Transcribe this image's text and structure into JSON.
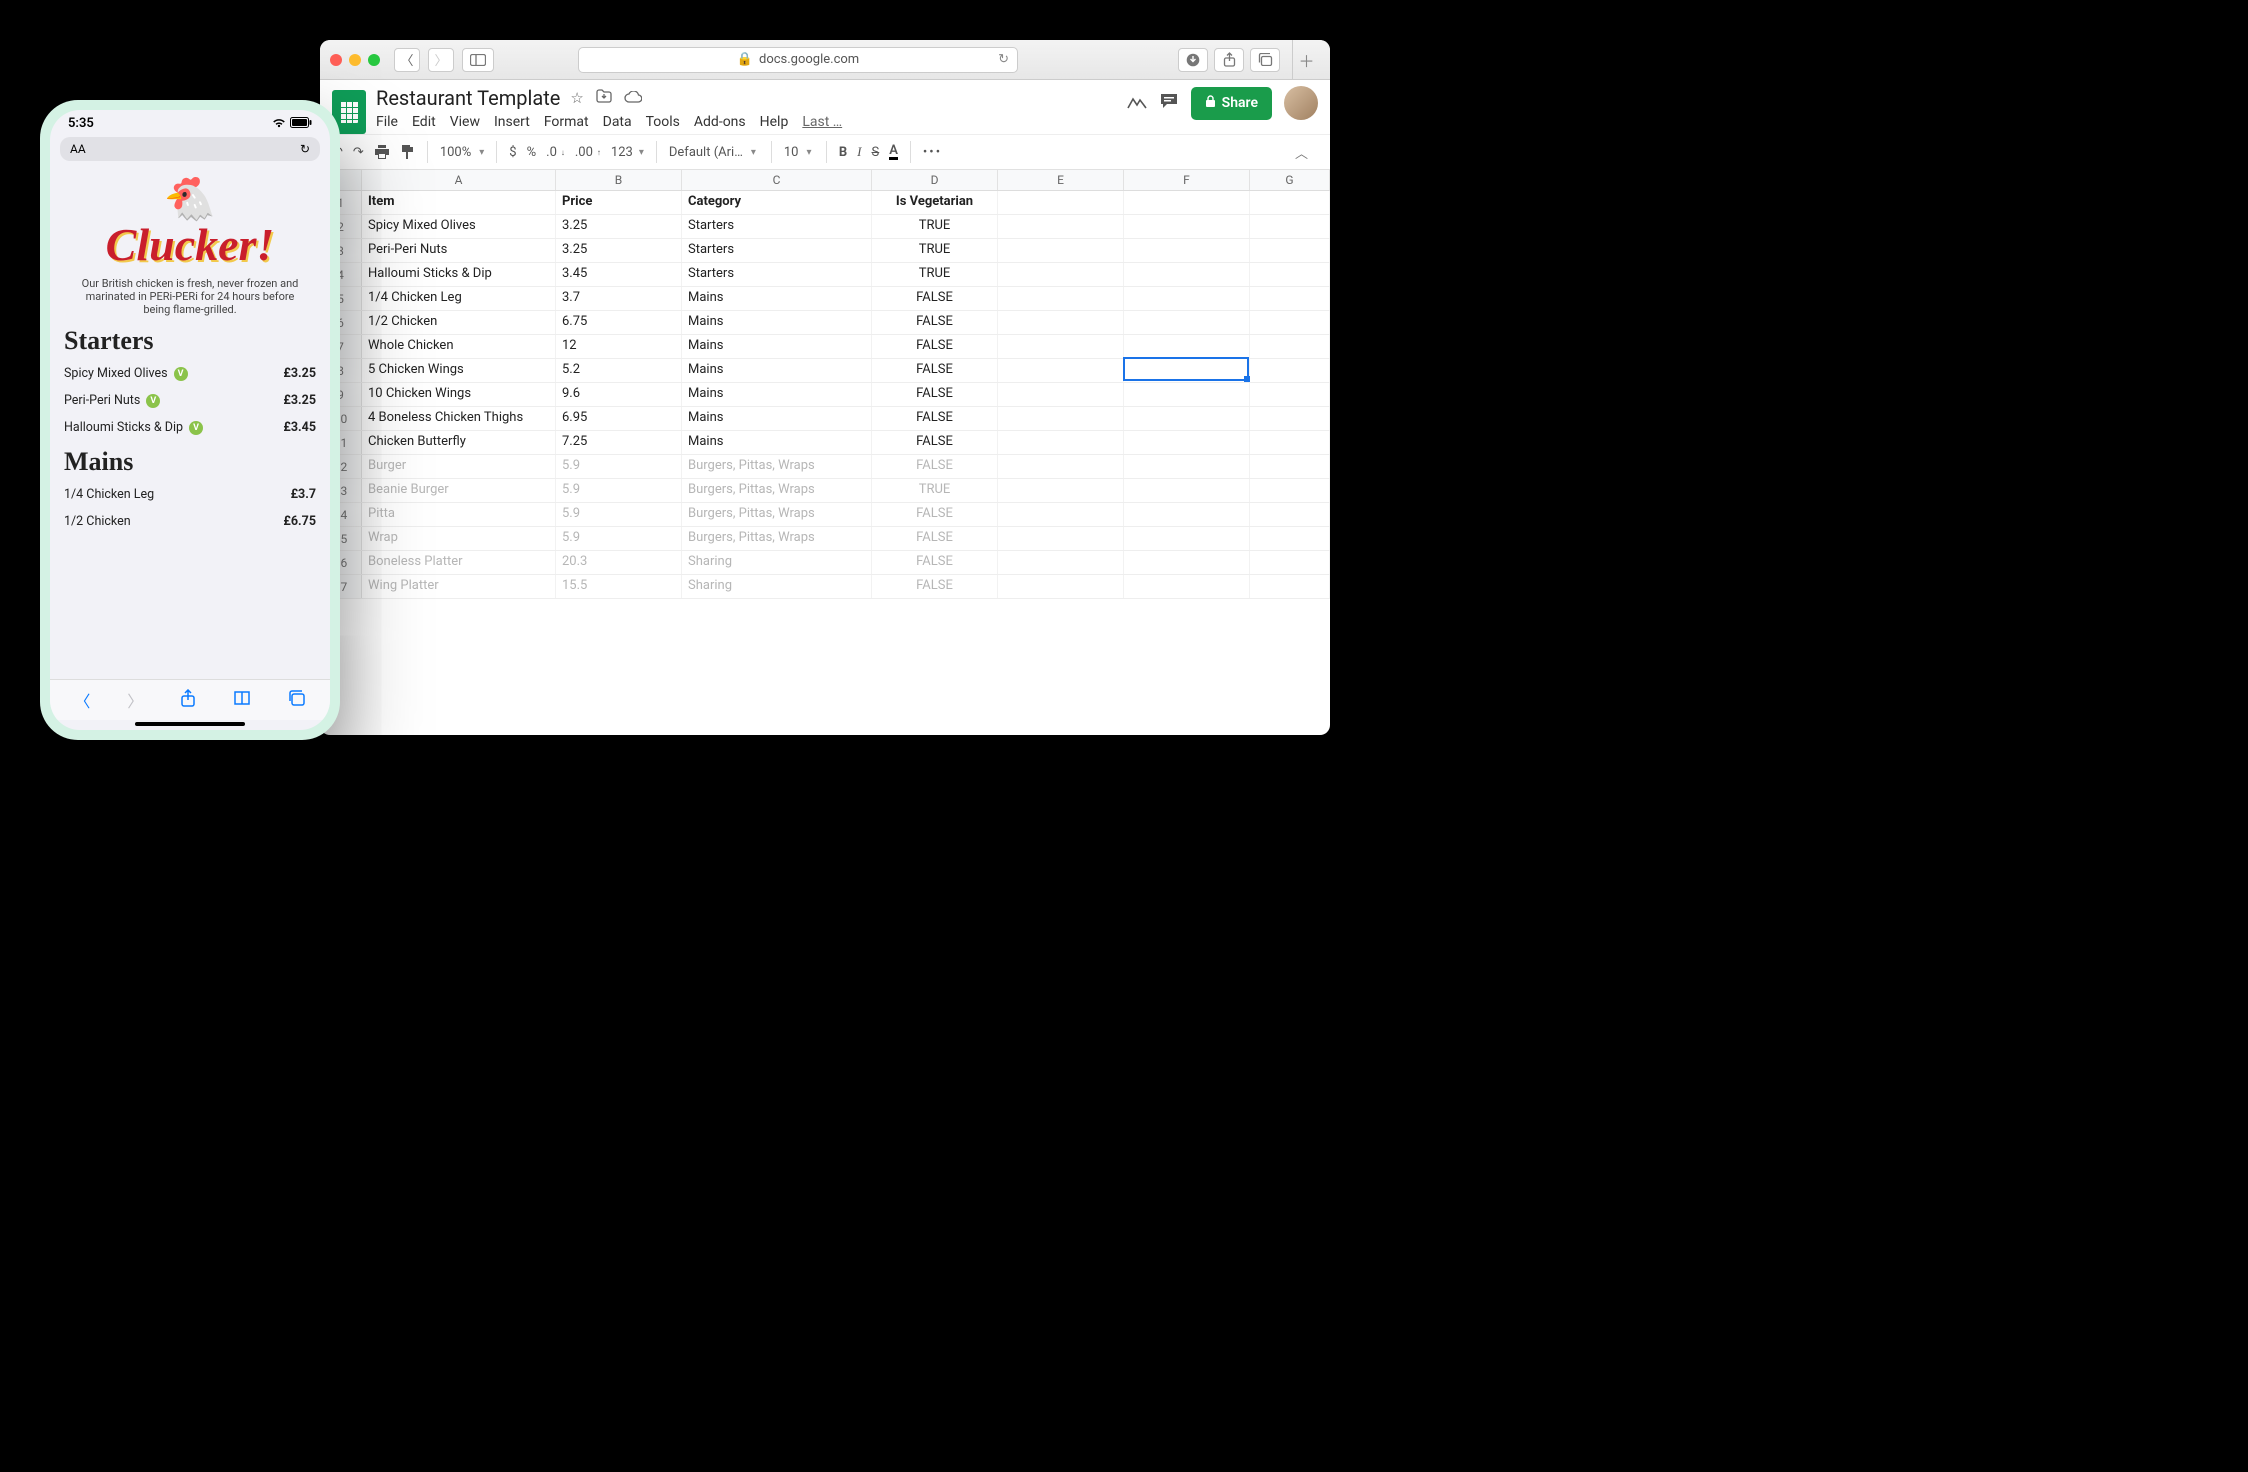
{
  "phone": {
    "time": "5:35",
    "url_aa": "AA",
    "brand": "Clucker!",
    "tagline": "Our British chicken is fresh, never frozen and marinated in PERi-PERi for 24 hours before being flame-grilled.",
    "sections": [
      {
        "title": "Starters",
        "items": [
          {
            "name": "Spicy Mixed Olives",
            "veg": true,
            "price": "£3.25"
          },
          {
            "name": "Peri-Peri Nuts",
            "veg": true,
            "price": "£3.25"
          },
          {
            "name": "Halloumi Sticks & Dip",
            "veg": true,
            "price": "£3.45"
          }
        ]
      },
      {
        "title": "Mains",
        "items": [
          {
            "name": "1/4 Chicken Leg",
            "veg": false,
            "price": "£3.7"
          },
          {
            "name": "1/2 Chicken",
            "veg": false,
            "price": "£6.75"
          }
        ]
      }
    ]
  },
  "safari": {
    "url_host": "docs.google.com"
  },
  "sheets": {
    "title": "Restaurant Template",
    "menu": [
      "File",
      "Edit",
      "View",
      "Insert",
      "Format",
      "Data",
      "Tools",
      "Add-ons",
      "Help"
    ],
    "last_label": "Last …",
    "share_label": "Share",
    "zoom": "100%",
    "font": "Default (Ari…",
    "size": "10",
    "columns": [
      "",
      "A",
      "B",
      "C",
      "D",
      "E",
      "F",
      "G"
    ],
    "header_row": [
      "Item",
      "Price",
      "Category",
      "Is Vegetarian",
      "",
      "",
      ""
    ],
    "data_rows": [
      {
        "cells": [
          "Spicy Mixed Olives",
          "3.25",
          "Starters",
          "TRUE",
          "",
          "",
          ""
        ],
        "faded": false
      },
      {
        "cells": [
          "Peri-Peri Nuts",
          "3.25",
          "Starters",
          "TRUE",
          "",
          "",
          ""
        ],
        "faded": false
      },
      {
        "cells": [
          "Halloumi Sticks & Dip",
          "3.45",
          "Starters",
          "TRUE",
          "",
          "",
          ""
        ],
        "faded": false
      },
      {
        "cells": [
          "1/4 Chicken Leg",
          "3.7",
          "Mains",
          "FALSE",
          "",
          "",
          ""
        ],
        "faded": false
      },
      {
        "cells": [
          "1/2 Chicken",
          "6.75",
          "Mains",
          "FALSE",
          "",
          "",
          ""
        ],
        "faded": false
      },
      {
        "cells": [
          "Whole Chicken",
          "12",
          "Mains",
          "FALSE",
          "",
          "",
          ""
        ],
        "faded": false
      },
      {
        "cells": [
          "5 Chicken Wings",
          "5.2",
          "Mains",
          "FALSE",
          "",
          "",
          ""
        ],
        "faded": false
      },
      {
        "cells": [
          "10 Chicken Wings",
          "9.6",
          "Mains",
          "FALSE",
          "",
          "",
          ""
        ],
        "faded": false
      },
      {
        "cells": [
          "4 Boneless Chicken Thighs",
          "6.95",
          "Mains",
          "FALSE",
          "",
          "",
          ""
        ],
        "faded": false
      },
      {
        "cells": [
          "Chicken Butterfly",
          "7.25",
          "Mains",
          "FALSE",
          "",
          "",
          ""
        ],
        "faded": false
      },
      {
        "cells": [
          "Burger",
          "5.9",
          "Burgers, Pittas, Wraps",
          "FALSE",
          "",
          "",
          ""
        ],
        "faded": true
      },
      {
        "cells": [
          "Beanie Burger",
          "5.9",
          "Burgers, Pittas, Wraps",
          "TRUE",
          "",
          "",
          ""
        ],
        "faded": true
      },
      {
        "cells": [
          "Pitta",
          "5.9",
          "Burgers, Pittas, Wraps",
          "FALSE",
          "",
          "",
          ""
        ],
        "faded": true
      },
      {
        "cells": [
          "Wrap",
          "5.9",
          "Burgers, Pittas, Wraps",
          "FALSE",
          "",
          "",
          ""
        ],
        "faded": true
      },
      {
        "cells": [
          "Boneless Platter",
          "20.3",
          "Sharing",
          "FALSE",
          "",
          "",
          ""
        ],
        "faded": true
      },
      {
        "cells": [
          "Wing Platter",
          "15.5",
          "Sharing",
          "FALSE",
          "",
          "",
          ""
        ],
        "faded": true
      }
    ],
    "active_cell": {
      "row": 8,
      "col": 6
    }
  }
}
